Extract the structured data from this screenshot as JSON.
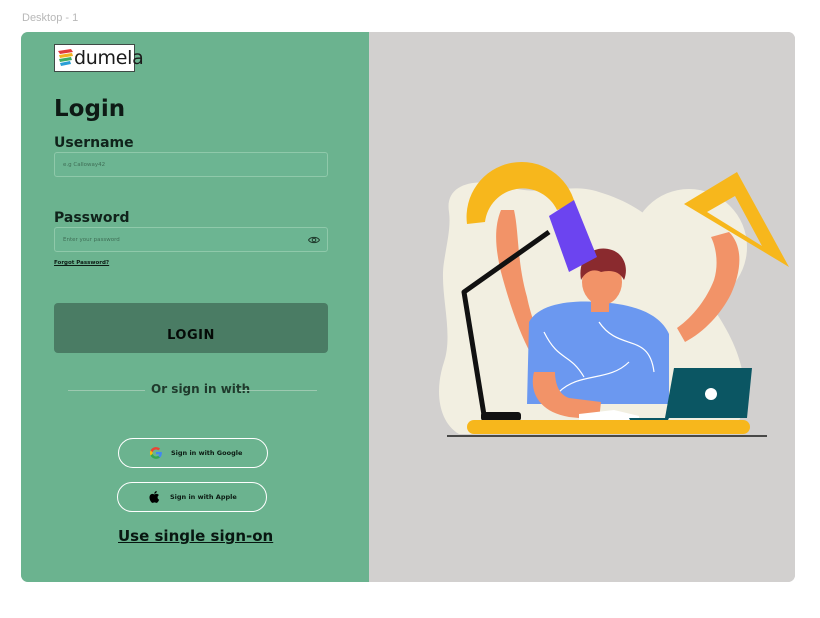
{
  "frame": {
    "label": "Desktop - 1"
  },
  "brand": {
    "name": "dumela",
    "colors": {
      "panel": "#6bb38f",
      "button": "#4a7c64",
      "illustration_bg": "#d2d0cf"
    }
  },
  "login": {
    "title": "Login",
    "username": {
      "label": "Username",
      "placeholder": "e.g Calloway42",
      "value": ""
    },
    "password": {
      "label": "Password",
      "placeholder": "Enter your password",
      "value": "",
      "toggle_icon": "eye-icon"
    },
    "forgot_link": "Forgot Password?",
    "submit_label": "LOGIN",
    "divider_text": "Or sign in with",
    "google": {
      "label": "Sign in with Google",
      "icon": "google-icon"
    },
    "apple": {
      "label": "Sign in with Apple",
      "icon": "apple-icon"
    },
    "sso_link": "Use single sign-on"
  },
  "illustration": {
    "subject": "person-at-desk-with-lamp-and-rulers"
  }
}
